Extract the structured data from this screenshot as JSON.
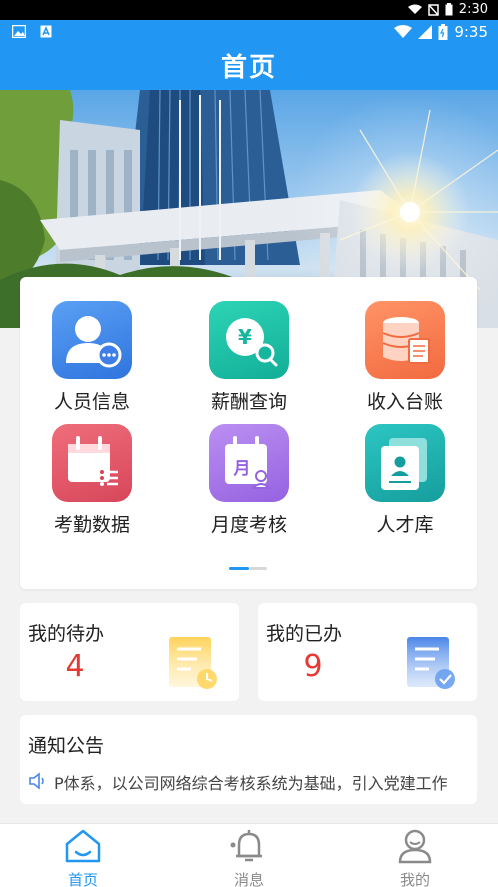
{
  "system_bar": {
    "time": "2:30"
  },
  "status_bar": {
    "time": "9:35"
  },
  "header": {
    "title": "首页"
  },
  "menu": {
    "items": [
      {
        "label": "人员信息",
        "icon": "person-info-icon",
        "color": "#3c86e8"
      },
      {
        "label": "薪酬查询",
        "icon": "salary-search-icon",
        "color": "#1cc0a6"
      },
      {
        "label": "收入台账",
        "icon": "coins-ledger-icon",
        "color": "#fb7c55"
      },
      {
        "label": "考勤数据",
        "icon": "calendar-list-icon",
        "color": "#e55a6a"
      },
      {
        "label": "月度考核",
        "icon": "monthly-calendar-icon",
        "color": "#a97ae8"
      },
      {
        "label": "人才库",
        "icon": "talent-cards-icon",
        "color": "#22b3b0"
      }
    ]
  },
  "todo": {
    "title": "我的待办",
    "count": "4"
  },
  "done": {
    "title": "我的已办",
    "count": "9"
  },
  "notice": {
    "title": "通知公告",
    "text": "P体系，以公司网络综合考核系统为基础，引入党建工作"
  },
  "tabs": [
    {
      "label": "首页",
      "active": true,
      "icon": "home-icon"
    },
    {
      "label": "消息",
      "active": false,
      "icon": "bell-icon"
    },
    {
      "label": "我的",
      "active": false,
      "icon": "user-icon"
    }
  ],
  "colors": {
    "primary": "#2196f3",
    "count_red": "#e53935",
    "inactive_tab": "#8a8a8a"
  }
}
